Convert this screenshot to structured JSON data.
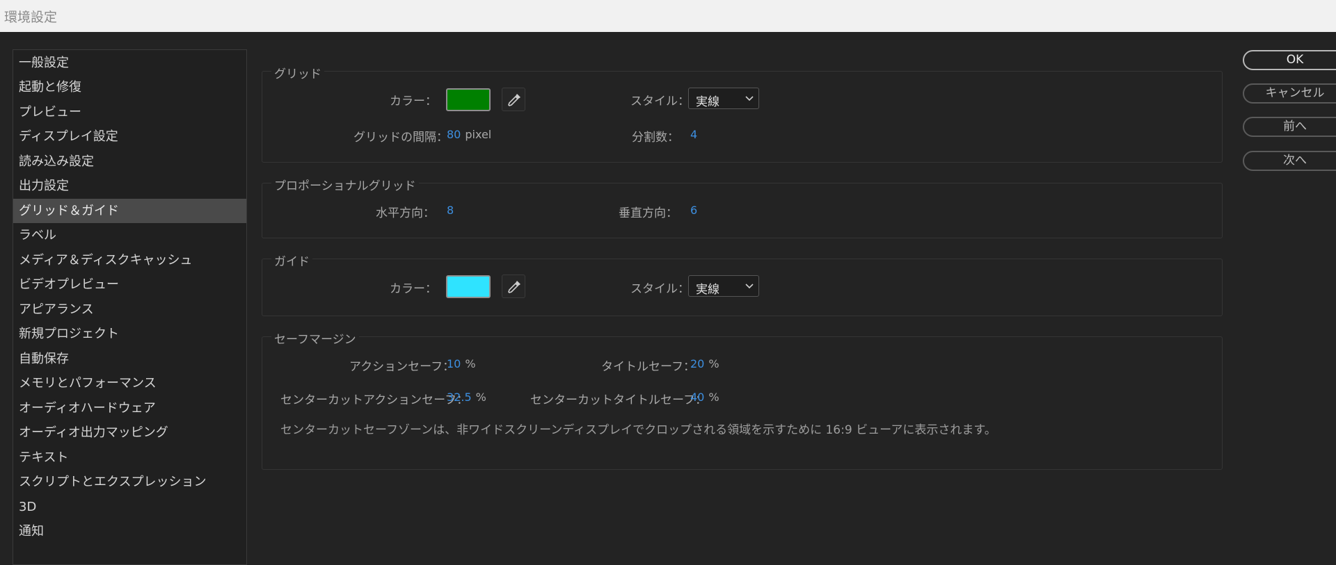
{
  "window": {
    "title": "環境設定"
  },
  "sidebar": {
    "items": [
      {
        "label": "一般設定"
      },
      {
        "label": "起動と修復"
      },
      {
        "label": "プレビュー"
      },
      {
        "label": "ディスプレイ設定"
      },
      {
        "label": "読み込み設定"
      },
      {
        "label": "出力設定"
      },
      {
        "label": "グリッド＆ガイド",
        "selected": true
      },
      {
        "label": "ラベル"
      },
      {
        "label": "メディア＆ディスクキャッシュ"
      },
      {
        "label": "ビデオプレビュー"
      },
      {
        "label": "アピアランス"
      },
      {
        "label": "新規プロジェクト"
      },
      {
        "label": "自動保存"
      },
      {
        "label": "メモリとパフォーマンス"
      },
      {
        "label": "オーディオハードウェア"
      },
      {
        "label": "オーディオ出力マッピング"
      },
      {
        "label": "テキスト"
      },
      {
        "label": "スクリプトとエクスプレッション"
      },
      {
        "label": "3D"
      },
      {
        "label": "通知"
      }
    ]
  },
  "grid": {
    "title": "グリッド",
    "color_label": "カラー：",
    "color": "#008000",
    "style_label": "スタイル：",
    "style_value": "実線",
    "spacing_label": "グリッドの間隔：",
    "spacing_value": "80",
    "spacing_unit": "pixel",
    "subdiv_label": "分割数：",
    "subdiv_value": "4"
  },
  "proportional_grid": {
    "title": "プロポーショナルグリッド",
    "horizontal_label": "水平方向：",
    "horizontal_value": "8",
    "vertical_label": "垂直方向：",
    "vertical_value": "6"
  },
  "guides": {
    "title": "ガイド",
    "color_label": "カラー：",
    "color": "#2fe3ff",
    "style_label": "スタイル：",
    "style_value": "実線"
  },
  "safe_margins": {
    "title": "セーフマージン",
    "action_safe_label": "アクションセーフ：",
    "action_safe_value": "10",
    "title_safe_label": "タイトルセーフ：",
    "title_safe_value": "20",
    "cc_action_safe_label": "センターカットアクションセーフ：",
    "cc_action_safe_value": "32.5",
    "cc_title_safe_label": "センターカットタイトルセーフ：",
    "cc_title_safe_value": "40",
    "percent": "%",
    "note": "センターカットセーフゾーンは、非ワイドスクリーンディスプレイでクロップされる領域を示すために 16:9 ビューアに表示されます。"
  },
  "buttons": {
    "ok": "OK",
    "cancel": "キャンセル",
    "previous": "前へ",
    "next": "次へ"
  }
}
